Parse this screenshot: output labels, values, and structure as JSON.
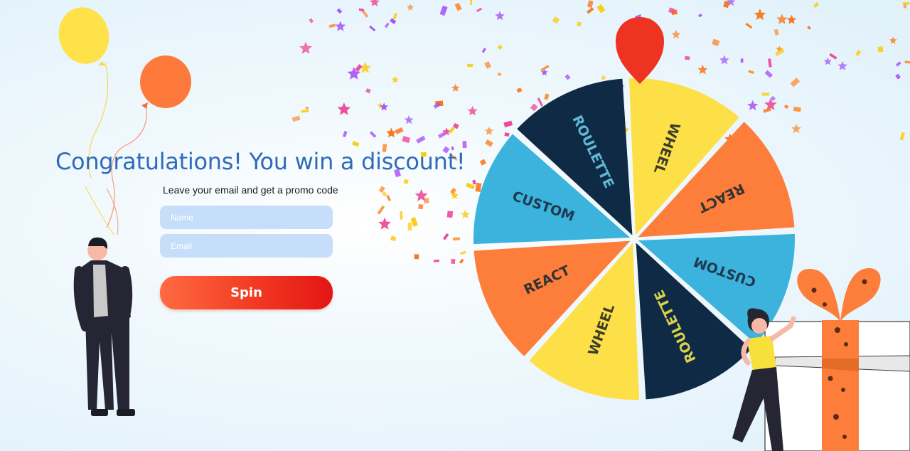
{
  "page": {
    "headline": "Congratulations!  You win a discount!",
    "subtext": "Leave your email and get a promo code"
  },
  "form": {
    "name_placeholder": "Name",
    "email_placeholder": "Email",
    "spin_label": "Spin"
  },
  "wheel": {
    "segments": [
      {
        "label": "WHEEL",
        "color": "#fde047",
        "text_color": "#3d3d2a"
      },
      {
        "label": "REACT",
        "color": "#fd7e3a",
        "text_color": "#333333"
      },
      {
        "label": "CUSTOM",
        "color": "#3bb3dd",
        "text_color": "#1e3a4f"
      },
      {
        "label": "ROULETTE",
        "color": "#0f2a44",
        "text_color": "#d8d24a"
      },
      {
        "label": "WHEEL",
        "color": "#fde047",
        "text_color": "#3d3d2a"
      },
      {
        "label": "REACT",
        "color": "#fd7e3a",
        "text_color": "#333333"
      },
      {
        "label": "CUSTOM",
        "color": "#3bb3dd",
        "text_color": "#1e3a4f"
      },
      {
        "label": "ROULETTE",
        "color": "#0f2a44",
        "text_color": "#5fb8d6"
      }
    ],
    "pointer_color": "#ef3323"
  },
  "decor": {
    "balloon_colors": [
      "#ffe14a",
      "#fe7a3c"
    ],
    "confetti_colors": [
      "#f97316",
      "#a855f7",
      "#facc15",
      "#ec4899",
      "#fb923c"
    ]
  }
}
